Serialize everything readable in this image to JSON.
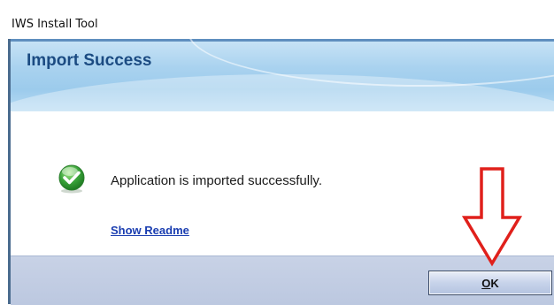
{
  "window": {
    "title": "IWS Install Tool"
  },
  "header": {
    "title": "Import Success"
  },
  "body": {
    "status_icon": "success-check-icon",
    "message": "Application is imported successfully.",
    "readme_link": "Show Readme"
  },
  "footer": {
    "ok_mnemonic": "O",
    "ok_rest": "K"
  },
  "annotation": {
    "icon": "down-arrow-icon",
    "color": "#e0201b"
  },
  "colors": {
    "header_title": "#1b4b82",
    "link": "#1a3db0",
    "success_green": "#3aa43a"
  }
}
